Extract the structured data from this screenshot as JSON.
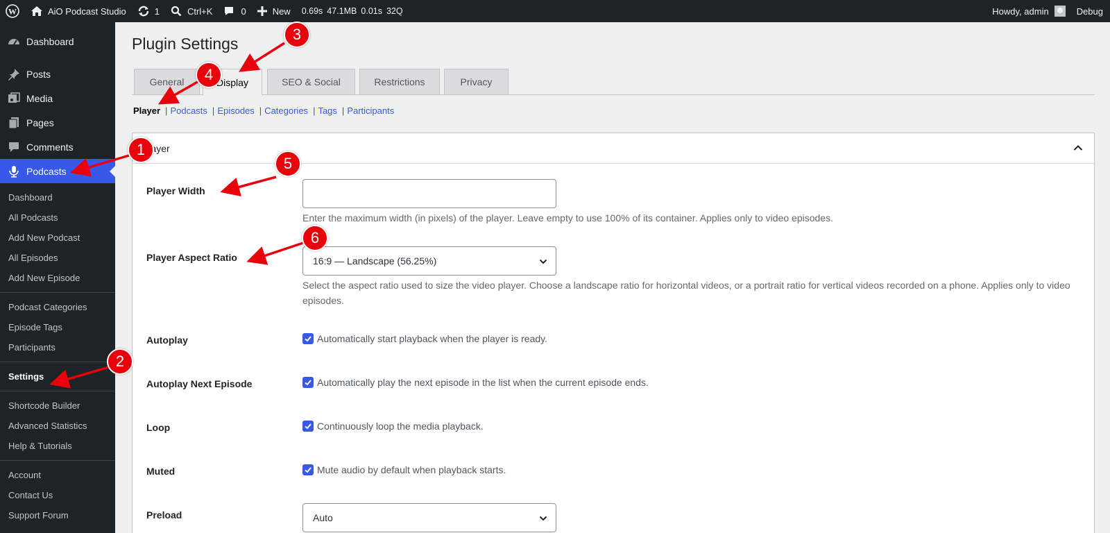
{
  "adminbar": {
    "site_name": "AiO Podcast Studio",
    "updates_count": "1",
    "search_shortcut": "Ctrl+K",
    "comments_count": "0",
    "new_label": "New",
    "qm_time": "0.69s",
    "qm_memory": "47.1MB",
    "qm_db_time": "0.01s",
    "qm_queries": "32Q",
    "howdy": "Howdy, admin",
    "debug": "Debug"
  },
  "sidebar": {
    "dashboard": "Dashboard",
    "posts": "Posts",
    "media": "Media",
    "pages": "Pages",
    "comments": "Comments",
    "podcasts": "Podcasts",
    "submenu": {
      "dashboard": "Dashboard",
      "all_podcasts": "All Podcasts",
      "add_new_podcast": "Add New Podcast",
      "all_episodes": "All Episodes",
      "add_new_episode": "Add New Episode",
      "podcast_categories": "Podcast Categories",
      "episode_tags": "Episode Tags",
      "participants": "Participants",
      "settings": "Settings",
      "shortcode_builder": "Shortcode Builder",
      "advanced_statistics": "Advanced Statistics",
      "help_tutorials": "Help & Tutorials",
      "account": "Account",
      "contact_us": "Contact Us",
      "support_forum": "Support Forum"
    }
  },
  "page": {
    "title": "Plugin Settings",
    "tabs": {
      "general": "General",
      "display": "Display",
      "seo_social": "SEO & Social",
      "restrictions": "Restrictions",
      "privacy": "Privacy"
    },
    "subnav": {
      "player": "Player",
      "podcasts": "Podcasts",
      "episodes": "Episodes",
      "categories": "Categories",
      "tags": "Tags",
      "participants": "Participants",
      "separator": "|"
    },
    "panel": {
      "title": "Player",
      "player_width": {
        "label": "Player Width",
        "value": "",
        "description": "Enter the maximum width (in pixels) of the player. Leave empty to use 100% of its container. Applies only to video episodes."
      },
      "aspect_ratio": {
        "label": "Player Aspect Ratio",
        "selected": "16:9 — Landscape (56.25%)",
        "description": "Select the aspect ratio used to size the video player. Choose a landscape ratio for horizontal videos, or a portrait ratio for vertical videos recorded on a phone. Applies only to video episodes."
      },
      "autoplay": {
        "label": "Autoplay",
        "checked": true,
        "text": "Automatically start playback when the player is ready."
      },
      "autoplay_next": {
        "label": "Autoplay Next Episode",
        "checked": true,
        "text": "Automatically play the next episode in the list when the current episode ends."
      },
      "loop": {
        "label": "Loop",
        "checked": true,
        "text": "Continuously loop the media playback."
      },
      "muted": {
        "label": "Muted",
        "checked": true,
        "text": "Mute audio by default when playback starts."
      },
      "preload": {
        "label": "Preload",
        "selected": "Auto"
      }
    }
  },
  "annotations": [
    "1",
    "2",
    "3",
    "4",
    "5",
    "6"
  ],
  "colors": {
    "adminbar_bg": "#1d2327",
    "accent": "#3858e9",
    "annotation_red": "#e8000b"
  }
}
